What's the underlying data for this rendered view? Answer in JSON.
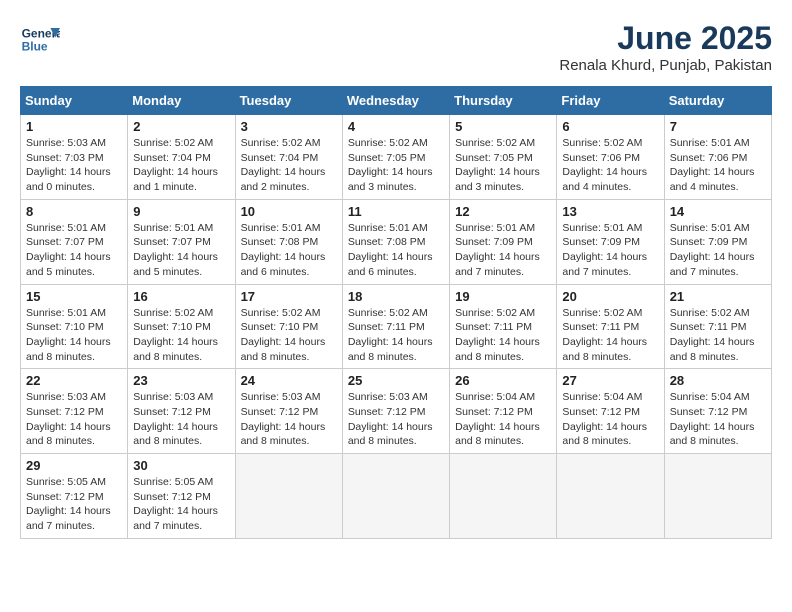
{
  "header": {
    "logo_line1": "General",
    "logo_line2": "Blue",
    "month": "June 2025",
    "location": "Renala Khurd, Punjab, Pakistan"
  },
  "weekdays": [
    "Sunday",
    "Monday",
    "Tuesday",
    "Wednesday",
    "Thursday",
    "Friday",
    "Saturday"
  ],
  "weeks": [
    [
      {
        "day": "1",
        "sunrise": "5:03 AM",
        "sunset": "7:03 PM",
        "daylight": "14 hours and 0 minutes."
      },
      {
        "day": "2",
        "sunrise": "5:02 AM",
        "sunset": "7:04 PM",
        "daylight": "14 hours and 1 minute."
      },
      {
        "day": "3",
        "sunrise": "5:02 AM",
        "sunset": "7:04 PM",
        "daylight": "14 hours and 2 minutes."
      },
      {
        "day": "4",
        "sunrise": "5:02 AM",
        "sunset": "7:05 PM",
        "daylight": "14 hours and 3 minutes."
      },
      {
        "day": "5",
        "sunrise": "5:02 AM",
        "sunset": "7:05 PM",
        "daylight": "14 hours and 3 minutes."
      },
      {
        "day": "6",
        "sunrise": "5:02 AM",
        "sunset": "7:06 PM",
        "daylight": "14 hours and 4 minutes."
      },
      {
        "day": "7",
        "sunrise": "5:01 AM",
        "sunset": "7:06 PM",
        "daylight": "14 hours and 4 minutes."
      }
    ],
    [
      {
        "day": "8",
        "sunrise": "5:01 AM",
        "sunset": "7:07 PM",
        "daylight": "14 hours and 5 minutes."
      },
      {
        "day": "9",
        "sunrise": "5:01 AM",
        "sunset": "7:07 PM",
        "daylight": "14 hours and 5 minutes."
      },
      {
        "day": "10",
        "sunrise": "5:01 AM",
        "sunset": "7:08 PM",
        "daylight": "14 hours and 6 minutes."
      },
      {
        "day": "11",
        "sunrise": "5:01 AM",
        "sunset": "7:08 PM",
        "daylight": "14 hours and 6 minutes."
      },
      {
        "day": "12",
        "sunrise": "5:01 AM",
        "sunset": "7:09 PM",
        "daylight": "14 hours and 7 minutes."
      },
      {
        "day": "13",
        "sunrise": "5:01 AM",
        "sunset": "7:09 PM",
        "daylight": "14 hours and 7 minutes."
      },
      {
        "day": "14",
        "sunrise": "5:01 AM",
        "sunset": "7:09 PM",
        "daylight": "14 hours and 7 minutes."
      }
    ],
    [
      {
        "day": "15",
        "sunrise": "5:01 AM",
        "sunset": "7:10 PM",
        "daylight": "14 hours and 8 minutes."
      },
      {
        "day": "16",
        "sunrise": "5:02 AM",
        "sunset": "7:10 PM",
        "daylight": "14 hours and 8 minutes."
      },
      {
        "day": "17",
        "sunrise": "5:02 AM",
        "sunset": "7:10 PM",
        "daylight": "14 hours and 8 minutes."
      },
      {
        "day": "18",
        "sunrise": "5:02 AM",
        "sunset": "7:11 PM",
        "daylight": "14 hours and 8 minutes."
      },
      {
        "day": "19",
        "sunrise": "5:02 AM",
        "sunset": "7:11 PM",
        "daylight": "14 hours and 8 minutes."
      },
      {
        "day": "20",
        "sunrise": "5:02 AM",
        "sunset": "7:11 PM",
        "daylight": "14 hours and 8 minutes."
      },
      {
        "day": "21",
        "sunrise": "5:02 AM",
        "sunset": "7:11 PM",
        "daylight": "14 hours and 8 minutes."
      }
    ],
    [
      {
        "day": "22",
        "sunrise": "5:03 AM",
        "sunset": "7:12 PM",
        "daylight": "14 hours and 8 minutes."
      },
      {
        "day": "23",
        "sunrise": "5:03 AM",
        "sunset": "7:12 PM",
        "daylight": "14 hours and 8 minutes."
      },
      {
        "day": "24",
        "sunrise": "5:03 AM",
        "sunset": "7:12 PM",
        "daylight": "14 hours and 8 minutes."
      },
      {
        "day": "25",
        "sunrise": "5:03 AM",
        "sunset": "7:12 PM",
        "daylight": "14 hours and 8 minutes."
      },
      {
        "day": "26",
        "sunrise": "5:04 AM",
        "sunset": "7:12 PM",
        "daylight": "14 hours and 8 minutes."
      },
      {
        "day": "27",
        "sunrise": "5:04 AM",
        "sunset": "7:12 PM",
        "daylight": "14 hours and 8 minutes."
      },
      {
        "day": "28",
        "sunrise": "5:04 AM",
        "sunset": "7:12 PM",
        "daylight": "14 hours and 8 minutes."
      }
    ],
    [
      {
        "day": "29",
        "sunrise": "5:05 AM",
        "sunset": "7:12 PM",
        "daylight": "14 hours and 7 minutes."
      },
      {
        "day": "30",
        "sunrise": "5:05 AM",
        "sunset": "7:12 PM",
        "daylight": "14 hours and 7 minutes."
      },
      null,
      null,
      null,
      null,
      null
    ]
  ]
}
